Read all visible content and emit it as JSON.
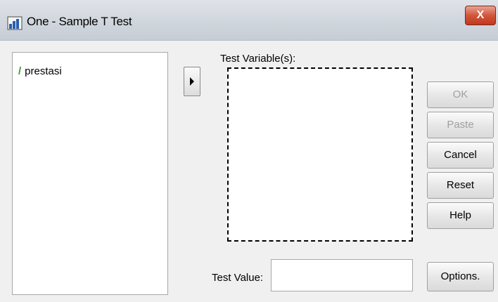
{
  "window": {
    "title": "One - Sample T Test",
    "close_label": "X"
  },
  "source_list": {
    "items": [
      {
        "icon": "pencil-variable-icon",
        "label": "prestasi"
      }
    ]
  },
  "target": {
    "label": "Test Variable(s):",
    "items": []
  },
  "buttons": {
    "ok": "OK",
    "paste": "Paste",
    "cancel": "Cancel",
    "reset": "Reset",
    "help": "Help",
    "options": "Options."
  },
  "test_value": {
    "label": "Test Value:",
    "value": ""
  },
  "colors": {
    "close_red": "#c0391d",
    "variable_icon_green": "#3b9d2a",
    "disabled_text": "#a0a0a0"
  }
}
